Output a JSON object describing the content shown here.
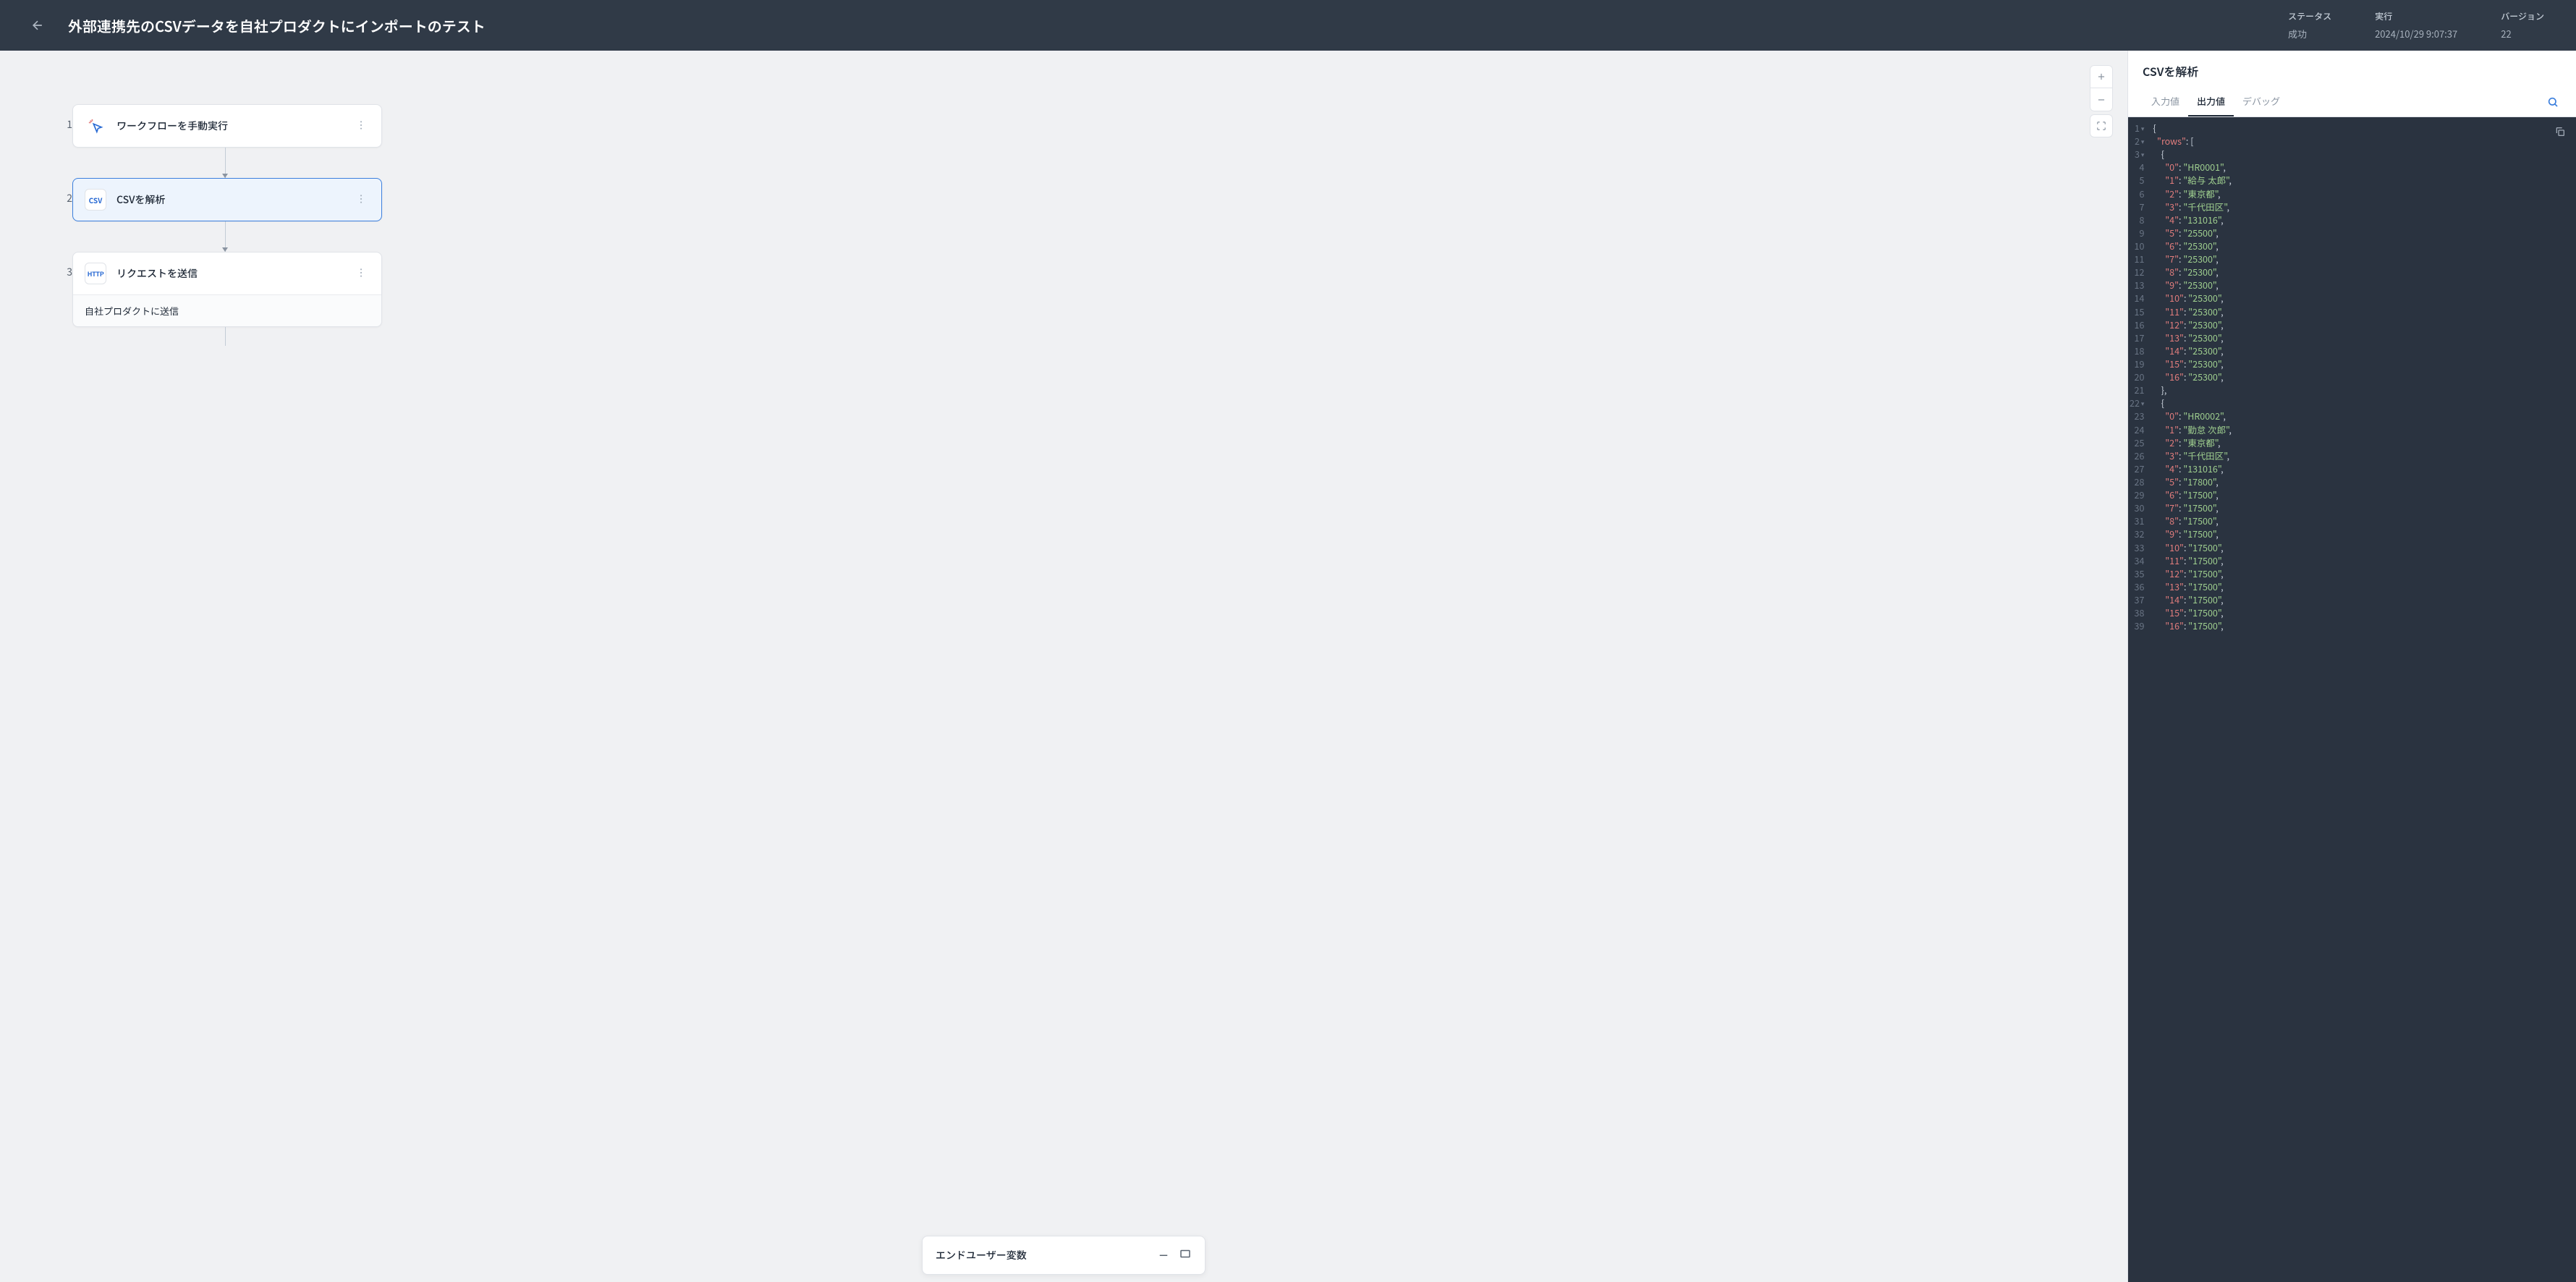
{
  "header": {
    "title": "外部連携先のCSVデータを自社プロダクトにインポートのテスト",
    "status_label": "ステータス",
    "status_value": "成功",
    "exec_label": "実行",
    "exec_value": "2024/10/29 9:07:37",
    "version_label": "バージョン",
    "version_value": "22"
  },
  "flow": {
    "nodes": [
      {
        "num": "1",
        "label": "ワークフローを手動実行",
        "icon": "trigger",
        "selected": false
      },
      {
        "num": "2",
        "label": "CSVを解析",
        "icon": "csv",
        "selected": true
      },
      {
        "num": "3",
        "label": "リクエストを送信",
        "icon": "http",
        "sub": "自社プロダクトに送信",
        "selected": false
      }
    ],
    "icon_text": {
      "csv": "CSV",
      "http": "HTTP"
    }
  },
  "bottom_panel": {
    "title": "エンドユーザー変数"
  },
  "side": {
    "title": "CSVを解析",
    "tabs": {
      "input": "入力値",
      "output": "出力値",
      "debug": "デバッグ"
    }
  },
  "code": {
    "rows_key": "rows",
    "data": [
      {
        "0": "HR0001",
        "1": "給与 太郎",
        "2": "東京都",
        "3": "千代田区",
        "4": "131016",
        "5": "25500",
        "6": "25300",
        "7": "25300",
        "8": "25300",
        "9": "25300",
        "10": "25300",
        "11": "25300",
        "12": "25300",
        "13": "25300",
        "14": "25300",
        "15": "25300",
        "16": "25300"
      },
      {
        "0": "HR0002",
        "1": "勤怠 次郎",
        "2": "東京都",
        "3": "千代田区",
        "4": "131016",
        "5": "17800",
        "6": "17500",
        "7": "17500",
        "8": "17500",
        "9": "17500",
        "10": "17500",
        "11": "17500",
        "12": "17500",
        "13": "17500",
        "14": "17500",
        "15": "17500",
        "16": "17500"
      }
    ]
  }
}
